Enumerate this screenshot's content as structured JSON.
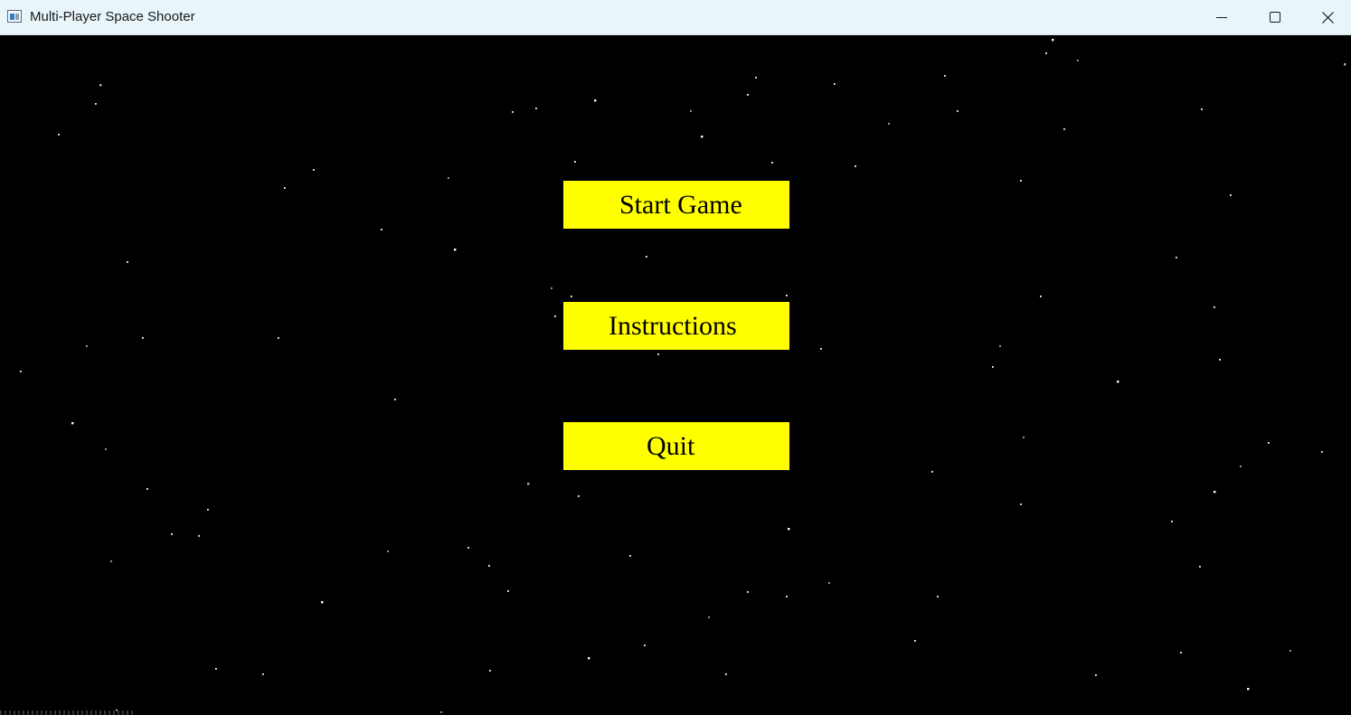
{
  "window": {
    "title": "Multi-Player Space Shooter",
    "icon": "app-window-icon",
    "controls": [
      "minimize-icon",
      "maximize-icon",
      "close-icon"
    ]
  },
  "menu": {
    "start_label": "Start Game",
    "instructions_label": "Instructions",
    "quit_label": "Quit"
  },
  "colors": {
    "background": "#000000",
    "button_fill": "#ffff00",
    "button_text": "#000000",
    "star": "#ffffff",
    "titlebar": "#e8f5f9"
  }
}
